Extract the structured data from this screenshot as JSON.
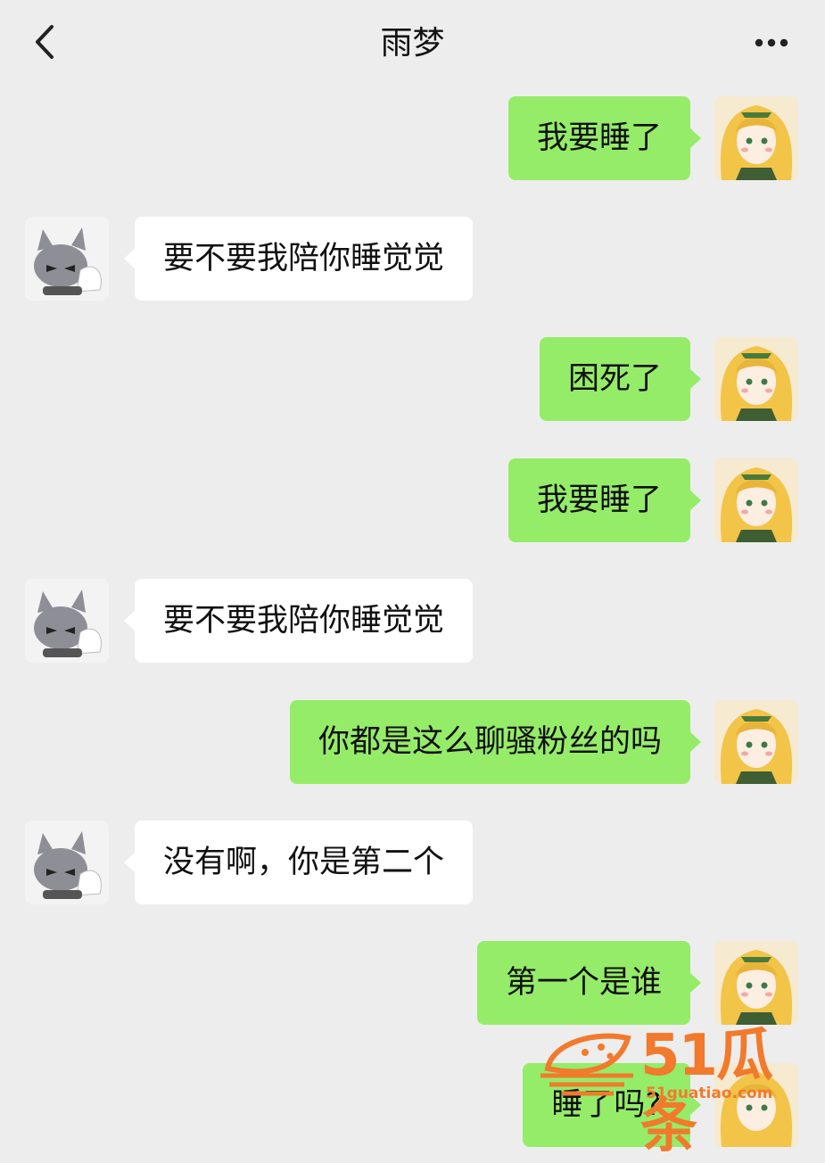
{
  "header": {
    "title": "雨梦",
    "back_icon": "chevron-left-icon",
    "more_icon": "more-dots-icon"
  },
  "colors": {
    "background": "#ededed",
    "sent_bubble": "#95ec69",
    "received_bubble": "#ffffff",
    "watermark": "#f17a2c"
  },
  "messages": [
    {
      "side": "me",
      "text": "我要睡了"
    },
    {
      "side": "them",
      "text": "要不要我陪你睡觉觉"
    },
    {
      "side": "me",
      "text": "困死了"
    },
    {
      "side": "me",
      "text": "我要睡了"
    },
    {
      "side": "them",
      "text": "要不要我陪你睡觉觉"
    },
    {
      "side": "me",
      "text": "你都是这么聊骚粉丝的吗"
    },
    {
      "side": "them",
      "text": "没有啊，你是第二个"
    },
    {
      "side": "me",
      "text": "第一个是谁"
    },
    {
      "side": "me",
      "text": "睡了吗?"
    }
  ],
  "watermark": {
    "brand": "51瓜条",
    "url": "51guatiao.com"
  }
}
